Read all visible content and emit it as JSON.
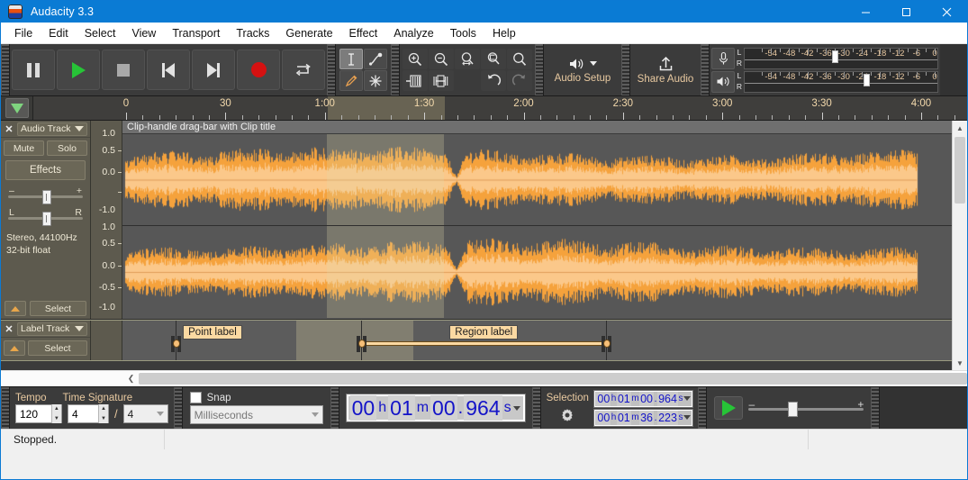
{
  "window": {
    "title": "Audacity 3.3",
    "icon": "audacity-logo-icon",
    "minimize": "–",
    "maximize": "❑",
    "close": "✕"
  },
  "menubar": {
    "items": [
      "File",
      "Edit",
      "Select",
      "View",
      "Transport",
      "Tracks",
      "Generate",
      "Effect",
      "Analyze",
      "Tools",
      "Help"
    ]
  },
  "transport": {
    "buttons": [
      {
        "name": "pause-button",
        "icon": "pause-icon"
      },
      {
        "name": "play-button",
        "icon": "play-icon"
      },
      {
        "name": "stop-button",
        "icon": "stop-icon"
      },
      {
        "name": "skip-to-start-button",
        "icon": "skip-start-icon"
      },
      {
        "name": "skip-to-end-button",
        "icon": "skip-end-icon"
      },
      {
        "name": "record-button",
        "icon": "record-icon"
      },
      {
        "name": "loop-button",
        "icon": "loop-icon"
      }
    ]
  },
  "tools": {
    "items": [
      {
        "name": "selection-tool",
        "icon": "i-beam-icon",
        "selected": true
      },
      {
        "name": "envelope-tool",
        "icon": "envelope-icon",
        "selected": false
      },
      {
        "name": "draw-tool",
        "icon": "pencil-icon",
        "selected": false
      },
      {
        "name": "multi-tool",
        "icon": "asterisk-icon",
        "selected": false
      }
    ]
  },
  "edit_toolbar": {
    "items": [
      {
        "name": "zoom-in-button",
        "icon": "zoom-in-icon"
      },
      {
        "name": "zoom-out-button",
        "icon": "zoom-out-icon"
      },
      {
        "name": "fit-selection-button",
        "icon": "fit-selection-icon"
      },
      {
        "name": "fit-project-button",
        "icon": "fit-project-icon"
      },
      {
        "name": "zoom-toggle-button",
        "icon": "zoom-toggle-icon"
      },
      {
        "name": "trim-audio-button",
        "icon": "trim-outside-icon"
      },
      {
        "name": "silence-audio-button",
        "icon": "silence-selection-icon"
      },
      {
        "name": "undo-button",
        "icon": "undo-icon"
      },
      {
        "name": "redo-button",
        "icon": "redo-icon"
      }
    ]
  },
  "audio_setup": {
    "label": "Audio Setup",
    "icon": "speaker-icon"
  },
  "share_audio": {
    "label": "Share Audio",
    "icon": "upload-icon"
  },
  "meters": {
    "record": {
      "icon": "microphone-icon",
      "left_label": "L",
      "right_label": "R",
      "cursor_db": -33
    },
    "play": {
      "icon": "speaker-icon",
      "left_label": "L",
      "right_label": "R",
      "cursor_db": -22.5
    },
    "scale_ticks": [
      -54,
      -48,
      -42,
      -36,
      -30,
      -24,
      -18,
      -12,
      -6,
      0
    ],
    "scale_min": -60,
    "scale_max": 0
  },
  "timeline": {
    "pin_button": {
      "name": "pinned-play-head-button",
      "icon": "play-head-triangle-icon"
    },
    "labels": [
      "0",
      "30",
      "1:00",
      "1:30",
      "2:00",
      "2:30",
      "3:00",
      "3:30",
      "4:00"
    ],
    "label_times_sec": [
      0,
      30,
      60,
      90,
      120,
      150,
      180,
      210,
      240
    ],
    "selection_start_sec": 60.964,
    "selection_end_sec": 96.223
  },
  "audio_track": {
    "close_label": "✕",
    "name": "Audio Track",
    "mute_label": "Mute",
    "solo_label": "Solo",
    "effects_label": "Effects",
    "gain_minus": "–",
    "gain_plus": "+",
    "pan_left": "L",
    "pan_right": "R",
    "info_line1": "Stereo, 44100Hz",
    "info_line2": "32-bit float",
    "select_label": "Select",
    "clip_title": "Clip-handle drag-bar with Clip title",
    "vertical_ruler_labels": [
      "1.0",
      "0.5",
      "0.0",
      "-0.5",
      "-1.0"
    ],
    "waveform_color": "#f5a23c",
    "waveform_rms_color": "#fbc88a",
    "background_color": "#575757"
  },
  "label_track": {
    "close_label": "✕",
    "name": "Label Track",
    "select_label": "Select",
    "labels": [
      {
        "text": "Point label",
        "type": "point",
        "time_sec": 24.5
      },
      {
        "text": "Region label",
        "type": "region",
        "start_sec": 80.5,
        "end_sec": 154.5
      }
    ]
  },
  "bottom_toolbar": {
    "tempo_label": "Tempo",
    "tempo_value": "120",
    "time_signature_label": "Time Signature",
    "time_signature_upper": "4",
    "time_signature_separator": "/",
    "time_signature_lower": "4",
    "snap_label": "Snap",
    "snap_checked": false,
    "snap_unit": "Milliseconds",
    "audio_position": {
      "hours": "00",
      "h_unit": "h",
      "minutes": "01",
      "m_unit": "m",
      "seconds": "00",
      "decimals": "964",
      "s_unit": "s"
    },
    "selection_label": "Selection",
    "selection_settings_icon": "gear-icon",
    "selection_start": {
      "hours": "00",
      "h_unit": "h",
      "minutes": "01",
      "m_unit": "m",
      "seconds": "00",
      "decimals": "964",
      "s_unit": "s"
    },
    "selection_end": {
      "hours": "00",
      "h_unit": "h",
      "minutes": "01",
      "m_unit": "m",
      "seconds": "36",
      "decimals": "223",
      "s_unit": "s"
    },
    "play_at_speed": {
      "icon": "play-icon",
      "minus": "–",
      "plus": "+"
    }
  },
  "statusbar": {
    "message": "Stopped.",
    "cell2": "",
    "cell3": ""
  },
  "colors": {
    "accent_blue": "#0a7bd4",
    "waveform": "#f5a23c",
    "panel": "#5d5a4e",
    "toolbar": "#3b3b3b",
    "label_amber": "#e8c9a0"
  }
}
